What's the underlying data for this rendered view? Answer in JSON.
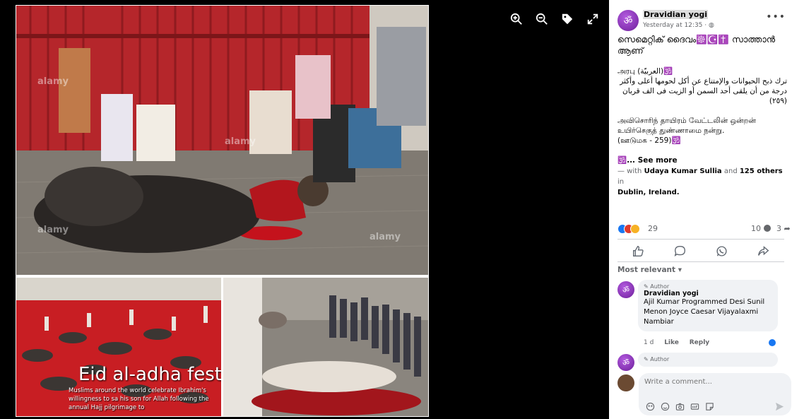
{
  "viewer": {
    "watermark": "alamy",
    "eid_title": "Eid al-adha festiv",
    "eid_caption": "Muslims around the world celebrate Ibrahim's willingness to sa his son for Allah following the annual Hajj pilgrimage to"
  },
  "post": {
    "author": "Dravidian yogi",
    "time": "Yesterday at 12:35 · ",
    "avatar_glyph": "ॐ",
    "line1": "സെമെറ്റിക് ദൈവം☸️☪️✝️ സാത്താൻ",
    "line2": "ആണ്",
    "arabic_label": "அரபு (العربيّة)🕉️",
    "arabic_text": "ترك ذبح الحيوانات والإمتناع عن أكل لحومها أعلى وأكثر درجة من أن يلقى أحد السمن أو الزيت فى الف قربان (٢٥٩)",
    "tamil1": "அவிசொரிந் தாயிரம் வேட்டலின் ஒன்றன்",
    "tamil2": "உயிர்செகுத் துண்ணாமை நன்று.",
    "tamil3": "(ஊடுமக - 259)🕉️",
    "see_more": "🕉️... See more",
    "with_prefix": "— with ",
    "with_names": "Udaya Kumar Sullia",
    "with_and": " and ",
    "with_others": "125 others",
    "with_in": " in",
    "location": "Dublin, Ireland."
  },
  "stats": {
    "reactions": "29",
    "comments": "10",
    "shares": "3"
  },
  "comments_section": {
    "sort_label": "Most relevant",
    "comments": [
      {
        "tag": "Author",
        "name": "Dravidian yogi",
        "text": "Ajil Kumar Programmed Desi Sunil Menon Joyce Caesar Vijayalaxmi Nambiar",
        "age": "1 d",
        "like": "Like",
        "reply": "Reply"
      },
      {
        "tag": "Author"
      }
    ],
    "write_placeholder": "Write a comment..."
  },
  "colors": {
    "accent": "#1877f2",
    "avatar_purple": "#8e3bbd",
    "blood": "#c4121c"
  }
}
